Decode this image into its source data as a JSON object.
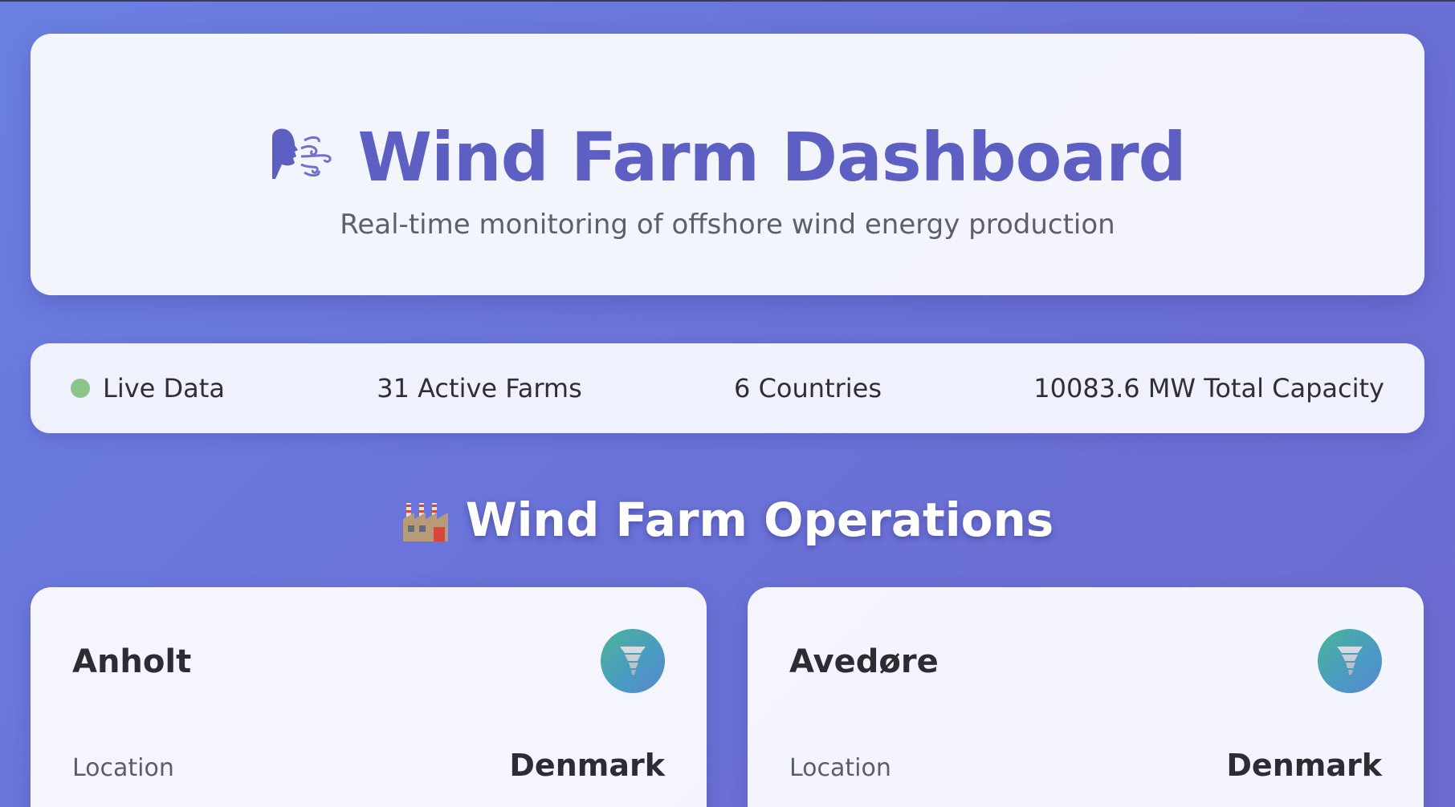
{
  "header": {
    "icon": "wind-face-icon",
    "title": "Wind Farm Dashboard",
    "subtitle": "Real-time monitoring of offshore wind energy production"
  },
  "status": {
    "live_label": "Live Data",
    "live_color": "#8bc58a",
    "active_farms": "31 Active Farms",
    "countries": "6 Countries",
    "capacity": "10083.6 MW Total Capacity"
  },
  "section": {
    "icon": "factory-icon",
    "title": "Wind Farm Operations"
  },
  "farms": [
    {
      "name": "Anholt",
      "icon": "tornado-icon",
      "location_label": "Location",
      "location": "Denmark"
    },
    {
      "name": "Avedøre",
      "icon": "tornado-icon",
      "location_label": "Location",
      "location": "Denmark"
    }
  ],
  "colors": {
    "accent": "#5d5fc2",
    "background": "#6a72d8"
  }
}
